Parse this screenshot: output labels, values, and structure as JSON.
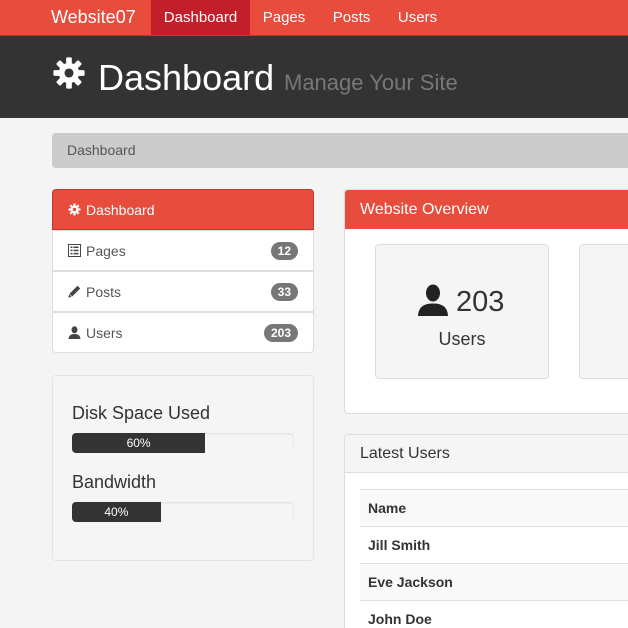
{
  "nav": {
    "brand": "Website07",
    "items": [
      {
        "label": "Dashboard",
        "active": true
      },
      {
        "label": "Pages"
      },
      {
        "label": "Posts"
      },
      {
        "label": "Users"
      }
    ]
  },
  "header": {
    "title": "Dashboard",
    "subtitle": "Manage Your Site",
    "icon": "gear-icon"
  },
  "breadcrumb": {
    "label": "Dashboard"
  },
  "sidebar": {
    "items": [
      {
        "label": "Dashboard",
        "icon": "gear-icon",
        "active": true
      },
      {
        "label": "Pages",
        "icon": "list-icon",
        "badge": "12"
      },
      {
        "label": "Posts",
        "icon": "pencil-icon",
        "badge": "33"
      },
      {
        "label": "Users",
        "icon": "user-icon",
        "badge": "203"
      }
    ]
  },
  "metrics": [
    {
      "label": "Disk Space Used",
      "value_text": "60%",
      "value": 0.6
    },
    {
      "label": "Bandwidth",
      "value_text": "40%",
      "value": 0.4
    }
  ],
  "overview": {
    "title": "Website Overview",
    "cards": [
      {
        "icon": "user-icon",
        "value": "203",
        "caption": "Users"
      }
    ]
  },
  "latest_users": {
    "title": "Latest Users",
    "columns": [
      "Name"
    ],
    "rows": [
      {
        "name": "Jill Smith"
      },
      {
        "name": "Eve Jackson"
      },
      {
        "name": "John Doe"
      }
    ]
  },
  "colors": {
    "accent": "#e74c3c",
    "accent_dark": "#c21f2b",
    "header_bg": "#333333",
    "page_bg": "#f4f4f4"
  }
}
